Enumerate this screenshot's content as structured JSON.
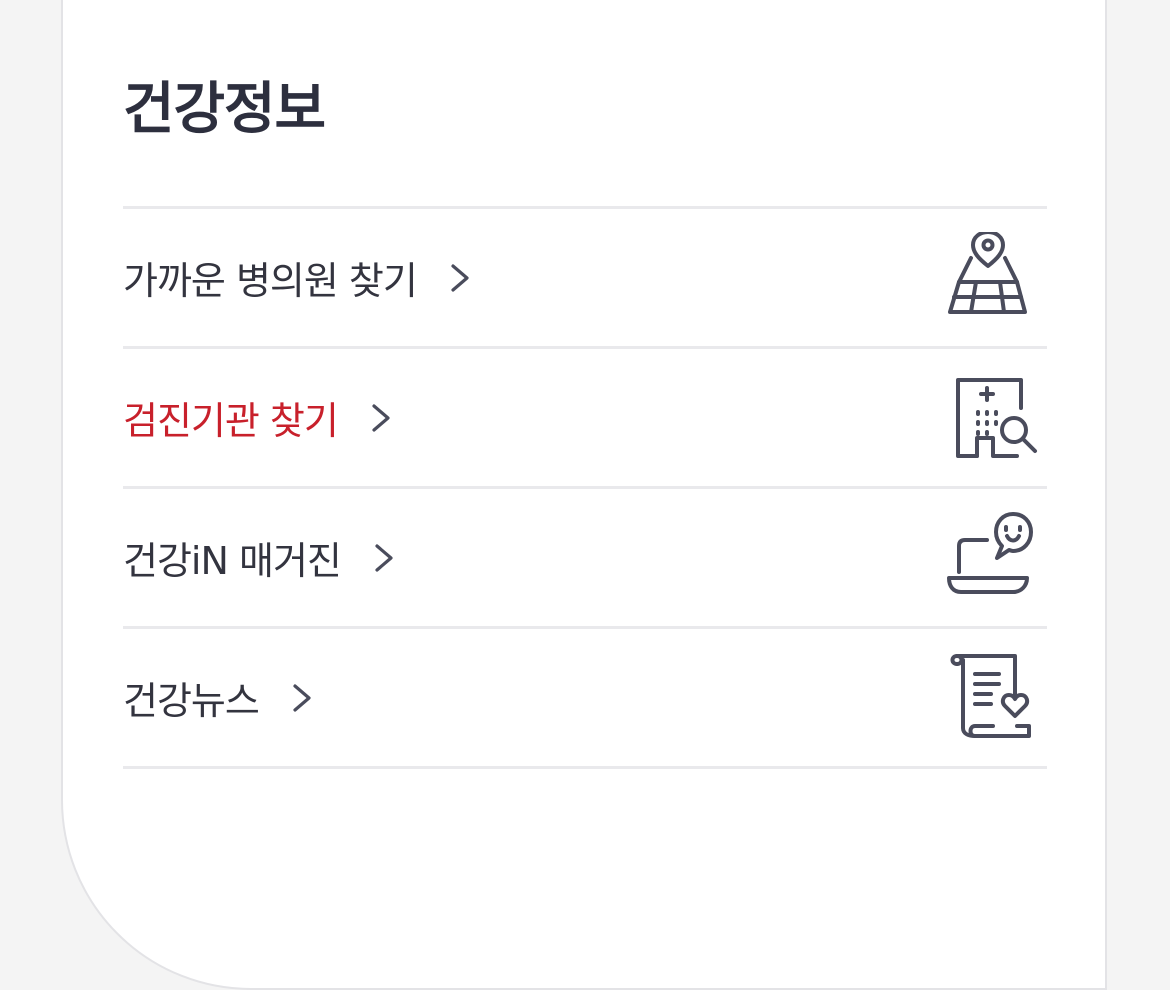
{
  "section": {
    "title": "건강정보"
  },
  "menu": {
    "items": [
      {
        "label": "가까운 병의원 찾기",
        "icon": "map-pin-icon",
        "active": false
      },
      {
        "label": "검진기관 찾기",
        "icon": "hospital-search-icon",
        "active": true
      },
      {
        "label": "건강iN 매거진",
        "icon": "laptop-chat-icon",
        "active": false
      },
      {
        "label": "건강뉴스",
        "icon": "news-scroll-heart-icon",
        "active": false
      }
    ]
  },
  "colors": {
    "title": "#2d2f3e",
    "text": "#33343f",
    "active": "#c8202b",
    "icon": "#4a4c5c",
    "divider": "#e9e9ec",
    "background": "#f4f4f4"
  }
}
